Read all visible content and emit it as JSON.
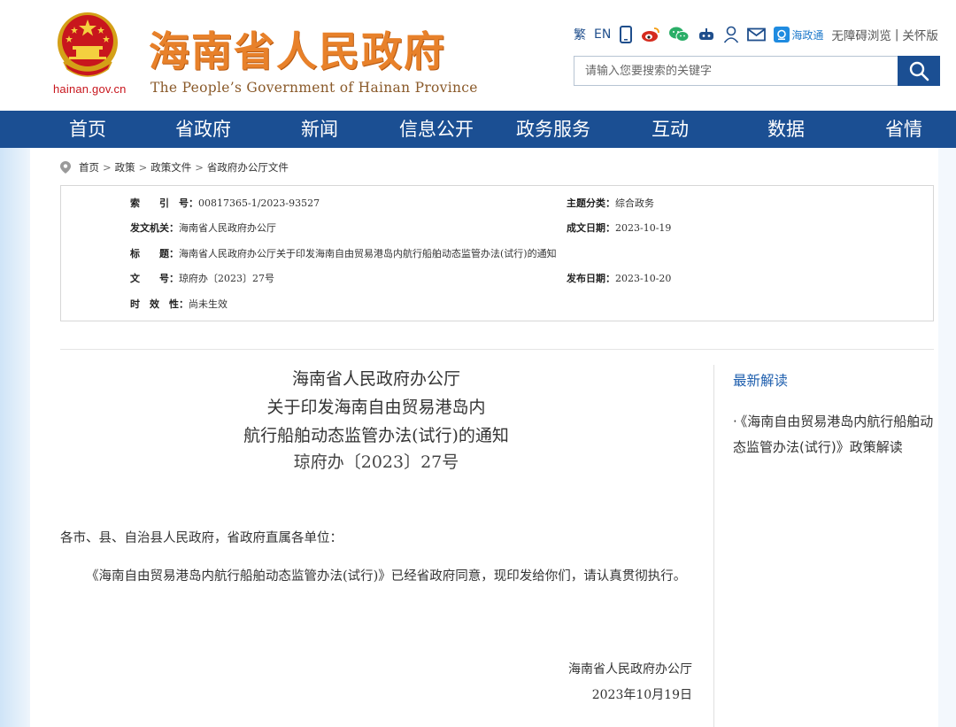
{
  "header": {
    "domain": "hainan.gov.cn",
    "logo_cn": "海南省人民政府",
    "logo_en": "The People’s Government  of Hainan Province",
    "toolbar": {
      "traditional": "繁",
      "english": "EN",
      "hainan_zwt": "海政通",
      "accessibility": "无障碍浏览",
      "separator": "|",
      "elderly": "关怀版"
    },
    "search": {
      "placeholder": "请输入您要搜索的关键字"
    }
  },
  "nav": {
    "items": [
      {
        "label": "首页"
      },
      {
        "label": "省政府"
      },
      {
        "label": "新闻"
      },
      {
        "label": "信息公开"
      },
      {
        "label": "政务服务"
      },
      {
        "label": "互动"
      },
      {
        "label": "数据"
      },
      {
        "label": "省情"
      }
    ]
  },
  "breadcrumb": [
    "首页",
    "政策",
    "政策文件",
    "省政府办公厅文件"
  ],
  "meta": {
    "index_label": "索　　引　号：",
    "index_value": "00817365-1/2023-93527",
    "topic_label": "主题分类：",
    "topic_value": "综合政务",
    "issuer_label": "发文机关：",
    "issuer_value": "海南省人民政府办公厅",
    "created_label": "成文日期：",
    "created_value": "2023-10-19",
    "title_label": "标　　题：",
    "title_value": "海南省人民政府办公厅关于印发海南自由贸易港岛内航行船舶动态监管办法(试行)的通知",
    "docno_label": "文　　号：",
    "docno_value": "琼府办〔2023〕27号",
    "published_label": "发布日期：",
    "published_value": "2023-10-20",
    "validity_label": "时　效　性：",
    "validity_value": "尚未生效"
  },
  "article": {
    "title_line1": "海南省人民政府办公厅",
    "title_line2": "关于印发海南自由贸易港岛内",
    "title_line3": "航行船舶动态监管办法(试行)的通知",
    "doc_number": "琼府办〔2023〕27号",
    "salutation": "各市、县、自治县人民政府，省政府直属各单位：",
    "paragraph1": "《海南自由贸易港岛内航行船舶动态监管办法(试行)》已经省政府同意，现印发给你们，请认真贯彻执行。",
    "signature": "海南省人民政府办公厅",
    "date": "2023年10月19日"
  },
  "sidebar": {
    "heading": "最新解读",
    "items": [
      {
        "bullet": "·",
        "label": "《海南自由贸易港岛内航行船舶动态监管办法(试行)》政策解读"
      }
    ]
  },
  "colors": {
    "nav_bg": "#1b4f93",
    "logo_orange": "#e8812a",
    "emblem_red": "#c8161d",
    "link_blue": "#1f5fae"
  }
}
